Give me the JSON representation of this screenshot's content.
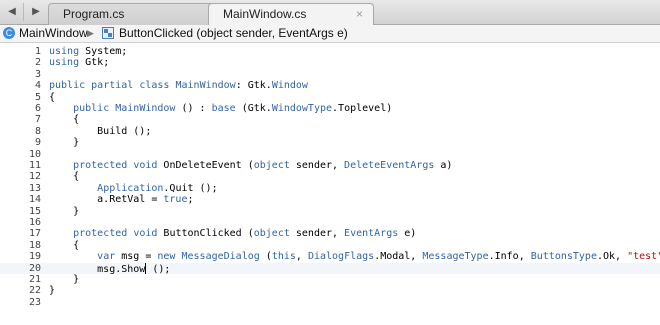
{
  "toolbar": {
    "back_icon": "left-arrow-icon",
    "forward_icon": "right-arrow-icon"
  },
  "tabs": [
    {
      "label": "Program.cs",
      "active": false,
      "close": "×"
    },
    {
      "label": "MainWindow.cs",
      "active": true,
      "close": "×"
    }
  ],
  "breadcrumb": {
    "class_name": "MainWindow",
    "separator": "▶",
    "method": "ButtonClicked (object sender, EventArgs e)"
  },
  "editor": {
    "current_line": 20,
    "colors": {
      "keyword": "#3364a4",
      "string": "#a3150f"
    },
    "lines": [
      {
        "n": "1",
        "tokens": [
          [
            "kw",
            "using"
          ],
          [
            "p",
            " System;"
          ]
        ]
      },
      {
        "n": "2",
        "tokens": [
          [
            "kw",
            "using"
          ],
          [
            "p",
            " Gtk;"
          ]
        ]
      },
      {
        "n": "3",
        "tokens": []
      },
      {
        "n": "4",
        "tokens": [
          [
            "kw",
            "public"
          ],
          [
            "p",
            " "
          ],
          [
            "kw",
            "partial"
          ],
          [
            "p",
            " "
          ],
          [
            "kw",
            "class"
          ],
          [
            "p",
            " "
          ],
          [
            "ty",
            "MainWindow"
          ],
          [
            "p",
            ": Gtk."
          ],
          [
            "ty",
            "Window"
          ]
        ]
      },
      {
        "n": "5",
        "tokens": [
          [
            "p",
            "{"
          ]
        ]
      },
      {
        "n": "6",
        "tokens": [
          [
            "p",
            "    "
          ],
          [
            "kw",
            "public"
          ],
          [
            "p",
            " "
          ],
          [
            "ty",
            "MainWindow"
          ],
          [
            "p",
            " () : "
          ],
          [
            "kw",
            "base"
          ],
          [
            "p",
            " (Gtk."
          ],
          [
            "ty",
            "WindowType"
          ],
          [
            "p",
            ".Toplevel)"
          ]
        ]
      },
      {
        "n": "7",
        "tokens": [
          [
            "p",
            "    {"
          ]
        ]
      },
      {
        "n": "8",
        "tokens": [
          [
            "p",
            "        Build ();"
          ]
        ]
      },
      {
        "n": "9",
        "tokens": [
          [
            "p",
            "    }"
          ]
        ]
      },
      {
        "n": "10",
        "tokens": []
      },
      {
        "n": "11",
        "tokens": [
          [
            "p",
            "    "
          ],
          [
            "kw",
            "protected"
          ],
          [
            "p",
            " "
          ],
          [
            "kw",
            "void"
          ],
          [
            "p",
            " OnDeleteEvent ("
          ],
          [
            "kw",
            "object"
          ],
          [
            "p",
            " sender, "
          ],
          [
            "ty",
            "DeleteEventArgs"
          ],
          [
            "p",
            " a)"
          ]
        ]
      },
      {
        "n": "12",
        "tokens": [
          [
            "p",
            "    {"
          ]
        ]
      },
      {
        "n": "13",
        "tokens": [
          [
            "p",
            "        "
          ],
          [
            "ty",
            "Application"
          ],
          [
            "p",
            ".Quit ();"
          ]
        ]
      },
      {
        "n": "14",
        "tokens": [
          [
            "p",
            "        a.RetVal = "
          ],
          [
            "kw",
            "true"
          ],
          [
            "p",
            ";"
          ]
        ]
      },
      {
        "n": "15",
        "tokens": [
          [
            "p",
            "    }"
          ]
        ]
      },
      {
        "n": "16",
        "tokens": []
      },
      {
        "n": "17",
        "tokens": [
          [
            "p",
            "    "
          ],
          [
            "kw",
            "protected"
          ],
          [
            "p",
            " "
          ],
          [
            "kw",
            "void"
          ],
          [
            "p",
            " ButtonClicked ("
          ],
          [
            "kw",
            "object"
          ],
          [
            "p",
            " sender, "
          ],
          [
            "ty",
            "EventArgs"
          ],
          [
            "p",
            " e)"
          ]
        ]
      },
      {
        "n": "18",
        "tokens": [
          [
            "p",
            "    {"
          ]
        ]
      },
      {
        "n": "19",
        "tokens": [
          [
            "p",
            "        "
          ],
          [
            "kw",
            "var"
          ],
          [
            "p",
            " msg = "
          ],
          [
            "kw",
            "new"
          ],
          [
            "p",
            " "
          ],
          [
            "ty",
            "MessageDialog"
          ],
          [
            "p",
            " ("
          ],
          [
            "kw",
            "this"
          ],
          [
            "p",
            ", "
          ],
          [
            "ty",
            "DialogFlags"
          ],
          [
            "p",
            ".Modal, "
          ],
          [
            "ty",
            "MessageType"
          ],
          [
            "p",
            ".Info, "
          ],
          [
            "ty",
            "ButtonsType"
          ],
          [
            "p",
            ".Ok, "
          ],
          [
            "str",
            "\"test\""
          ],
          [
            "p",
            ");"
          ]
        ]
      },
      {
        "n": "20",
        "tokens": [
          [
            "p",
            "        msg.Show"
          ],
          [
            "caret",
            ""
          ],
          [
            "p",
            " ();"
          ]
        ]
      },
      {
        "n": "21",
        "tokens": [
          [
            "p",
            "    }"
          ]
        ]
      },
      {
        "n": "22",
        "tokens": [
          [
            "p",
            "}"
          ]
        ]
      },
      {
        "n": "23",
        "tokens": []
      }
    ]
  }
}
